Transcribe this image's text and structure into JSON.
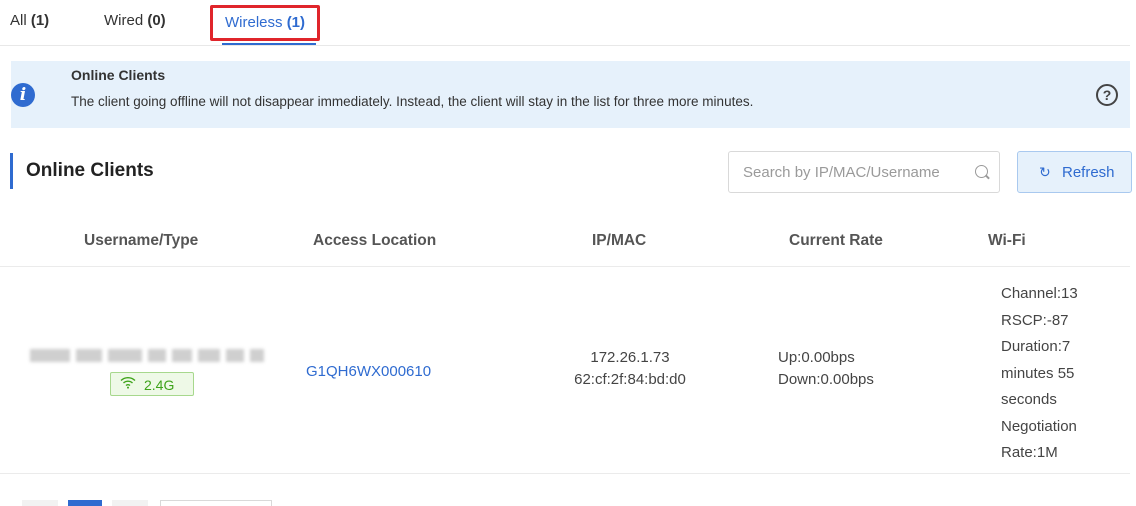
{
  "tabs": [
    {
      "label": "All",
      "count": "(1)"
    },
    {
      "label": "Wired",
      "count": "(0)"
    },
    {
      "label": "Wireless",
      "count": "(1)"
    }
  ],
  "notice": {
    "title": "Online Clients",
    "text": "The client going offline will not disappear immediately. Instead, the client will stay in the list for three more minutes.",
    "info_icon": "i",
    "help_icon": "?"
  },
  "section": {
    "title": "Online Clients",
    "search_placeholder": "Search by IP/MAC/Username",
    "refresh_label": "Refresh"
  },
  "table": {
    "headers": [
      "Username/Type",
      "Access Location",
      "IP/MAC",
      "Current Rate",
      "Wi-Fi"
    ],
    "rows": [
      {
        "band": "2.4G",
        "access_location": "G1QH6WX000610",
        "ip": "172.26.1.73",
        "mac": "62:cf:2f:84:bd:d0",
        "up": "Up:0.00bps",
        "down": "Down:0.00bps",
        "wifi": [
          "Channel:13",
          "RSCP:-87",
          "Duration:7",
          "minutes 55",
          "seconds",
          "Negotiation",
          "Rate:1M"
        ]
      }
    ]
  },
  "colors": {
    "accent": "#2f6bd0",
    "highlight_border": "#e0252b",
    "notice_bg": "#e6f1fb",
    "badge_green": "#3ea31a"
  }
}
